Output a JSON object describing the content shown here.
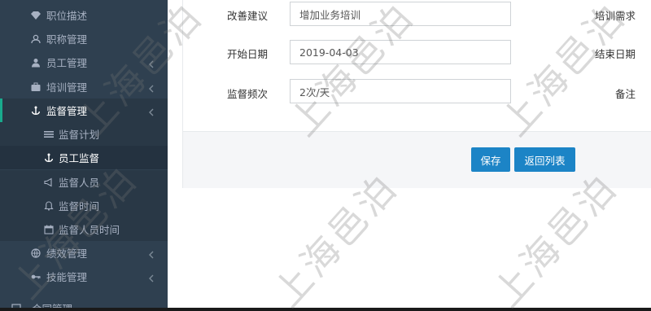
{
  "sidebar": {
    "items": [
      {
        "label": "职位描述",
        "icon": "diamond-icon",
        "has_arrow": false
      },
      {
        "label": "职称管理",
        "icon": "users-icon",
        "has_arrow": false
      },
      {
        "label": "员工管理",
        "icon": "user-icon",
        "has_arrow": true
      },
      {
        "label": "培训管理",
        "icon": "briefcase-icon",
        "has_arrow": true
      },
      {
        "label": "监督管理",
        "icon": "anchor-icon",
        "has_arrow": true,
        "active": true
      }
    ],
    "subitems": [
      {
        "label": "监督计划",
        "icon": "list-icon"
      },
      {
        "label": "员工监督",
        "icon": "anchor-icon",
        "active": true
      },
      {
        "label": "监督人员",
        "icon": "bullhorn-icon"
      },
      {
        "label": "监督时间",
        "icon": "bell-icon"
      },
      {
        "label": "监督人员时间",
        "icon": "calendar-icon"
      }
    ],
    "more_items": [
      {
        "label": "绩效管理",
        "icon": "globe-icon",
        "has_arrow": true
      },
      {
        "label": "技能管理",
        "icon": "key-icon",
        "has_arrow": true
      },
      {
        "label": "合同管理",
        "icon": "square-icon",
        "has_arrow": false
      }
    ]
  },
  "form": {
    "improvement_label": "改善建议",
    "improvement_value": "增加业务培训",
    "training_need_label": "培训需求",
    "start_date_label": "开始日期",
    "start_date_value": "2019-04-03",
    "end_date_label": "结束日期",
    "frequency_label": "监督频次",
    "frequency_value": "2次/天",
    "remark_label": "备注"
  },
  "buttons": {
    "save": "保存",
    "back": "返回列表"
  },
  "watermark_text": "上海邑泊",
  "colors": {
    "sidebar_bg": "#2f4050",
    "primary": "#1c84c6",
    "active_border": "#19aa8d"
  }
}
